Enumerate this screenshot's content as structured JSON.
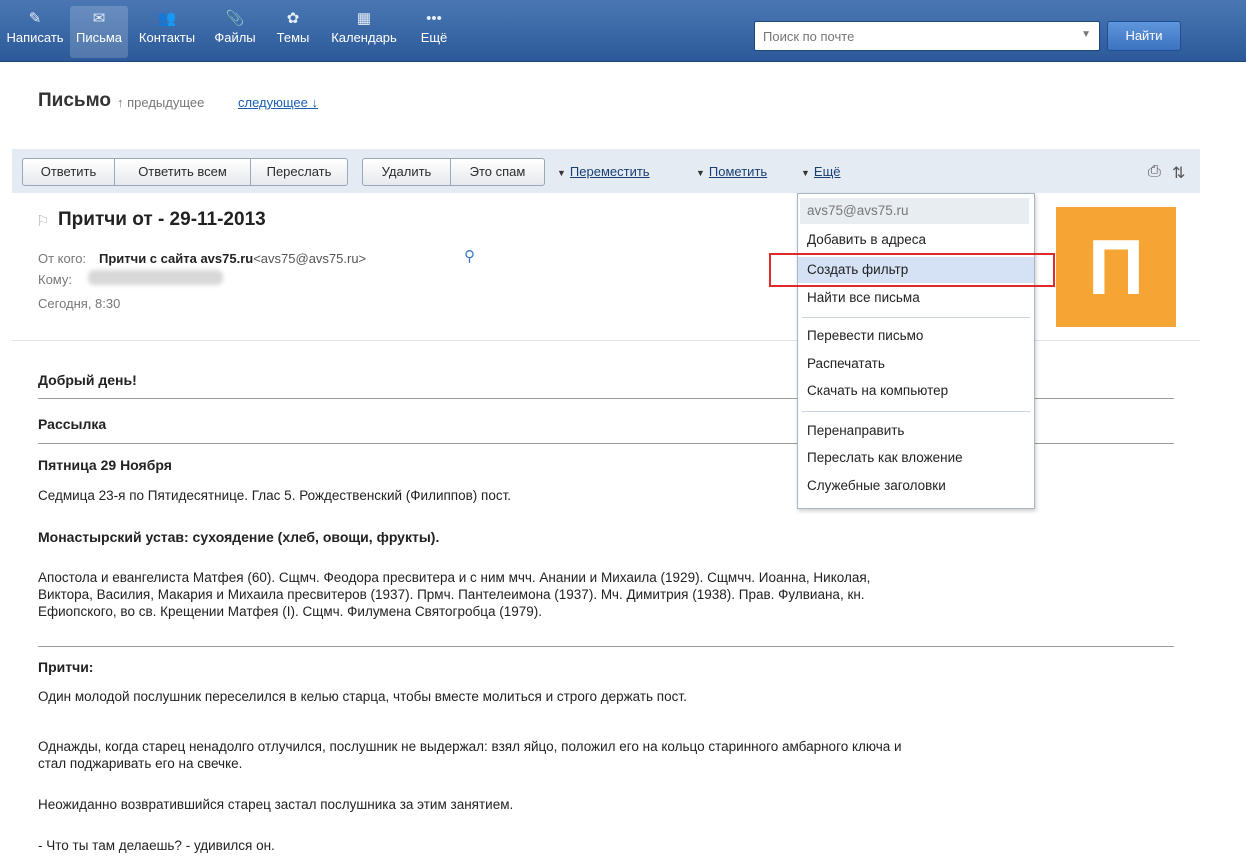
{
  "nav": {
    "items": [
      {
        "icon": "pencil-icon",
        "glyph": "✎",
        "label": "Написать"
      },
      {
        "icon": "envelope-icon",
        "glyph": "✉",
        "label": "Письма"
      },
      {
        "icon": "contacts-icon",
        "glyph": "👥",
        "label": "Контакты"
      },
      {
        "icon": "paperclip-icon",
        "glyph": "📎",
        "label": "Файлы"
      },
      {
        "icon": "themes-icon",
        "glyph": "✿",
        "label": "Темы"
      },
      {
        "icon": "calendar-icon",
        "glyph": "▦",
        "label": "Календарь"
      },
      {
        "icon": "more-dots-icon",
        "glyph": "•••",
        "label": "Ещё"
      }
    ],
    "active_index": 1
  },
  "search": {
    "placeholder": "Поиск по почте",
    "button_label": "Найти"
  },
  "title_row": {
    "title": "Письмо",
    "prev": "↑ предыдущее",
    "next": "следующее ↓"
  },
  "toolbar": {
    "reply": "Ответить",
    "reply_all": "Ответить всем",
    "forward": "Переслать",
    "delete": "Удалить",
    "spam": "Это спам",
    "move": "Переместить",
    "mark": "Пометить",
    "more": "Ещё"
  },
  "message": {
    "subject": "Притчи от - 29-11-2013",
    "from_label": "От кого:",
    "from_name": "Притчи с сайта avs75.ru",
    "from_address": "<avs75@avs75.ru>",
    "to_label": "Кому:",
    "date": "Сегодня, 8:30",
    "avatar_letter": "П",
    "avatar_color": "#f5a534"
  },
  "menu": {
    "email": "avs75@avs75.ru",
    "items": [
      "Добавить в адреса",
      "Создать фильтр",
      "Найти все письма",
      "Перевести письмо",
      "Распечатать",
      "Скачать на компьютер",
      "Перенаправить",
      "Переслать как вложение",
      "Служебные заголовки"
    ],
    "highlighted": "Создать фильтр"
  },
  "body": {
    "greeting": "Добрый день!",
    "section": "Рассылка",
    "day": "Пятница 29 Ноября",
    "week": "Седмица 23-я по Пятидесятнице. Глас 5. Рождественский (Филиппов) пост.",
    "rule": "Монастырский устав: сухоядение (хлеб, овощи, фрукты).",
    "saints_1": "Апостола и евангелиста Матфея (60). Сщмч. Феодора пресвитера и с ним мчч. Анании и Михаила (1929). Сщмчч. Иоанна, Николая,",
    "saints_2": "Виктора, Василия, Макария и Михаила пресвитеров (1937). Прмч. Пантелеимона (1937). Мч. Димитрия (1938). Прав. Фулвиана, кн.",
    "saints_3": "Ефиопского, во св. Крещении Матфея (I). Сщмч. Филумена Святогробца (1979).",
    "parables_heading": "Притчи:",
    "p1": "Один молодой послушник переселился в келью старца, чтобы вместе молиться и строго держать пост.",
    "p2_1": "Однажды, когда старец ненадолго отлучился, послушник не выдержал: взял яйцо, положил его на кольцо старинного амбарного ключа и",
    "p2_2": "стал поджаривать его на свечке.",
    "p3": "Неожиданно возвратившийся старец застал послушника за этим занятием.",
    "p4": "- Что ты там делаешь? - удивился он."
  }
}
